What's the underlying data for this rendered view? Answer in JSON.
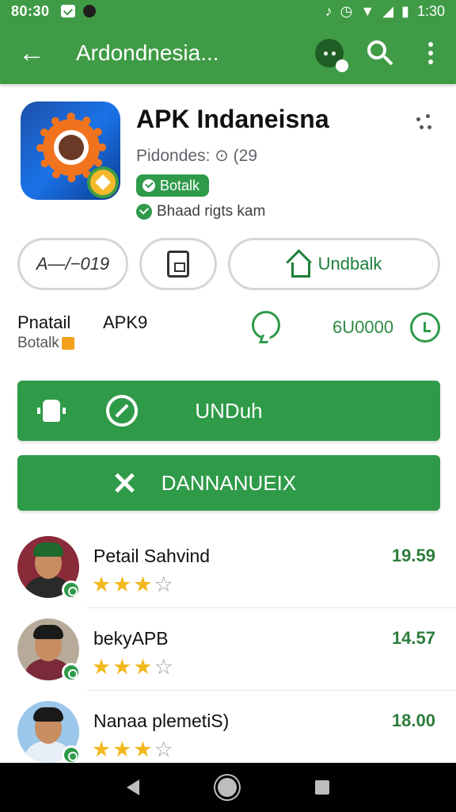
{
  "status_bar": {
    "time": "80:30",
    "right_time": "1:30"
  },
  "toolbar": {
    "title": "Ardondnesia...",
    "back_icon": "arrow-left-icon",
    "chat_icon": "chat-icon",
    "search_icon": "search-icon",
    "more_icon": "more-vert-icon"
  },
  "app": {
    "title": "APK Indaneisna",
    "developer": "Pidondes: ⊙ (29",
    "badge": "Botalk",
    "verified_text": "Bhaad rigts kam"
  },
  "chips": {
    "signature": "A—/−019",
    "download_label": "Undbalk"
  },
  "info": {
    "label_1": "Pnatail",
    "label_2": "APK9",
    "sub": "Botalk",
    "count": "6U0000"
  },
  "buttons": {
    "primary": "UNDuh",
    "secondary": "DANNANUEIX"
  },
  "reviews": [
    {
      "name": "Petail Sahvind",
      "rating": 3,
      "score": "19.59"
    },
    {
      "name": "bekyAPB",
      "rating": 3,
      "score": "14.57"
    },
    {
      "name": "Nanaa plemetiS)",
      "rating": 3,
      "score": "18.00"
    }
  ],
  "colors": {
    "brand_green": "#3f9b45",
    "button_green": "#2f9a48",
    "star_yellow": "#f3b71e"
  }
}
